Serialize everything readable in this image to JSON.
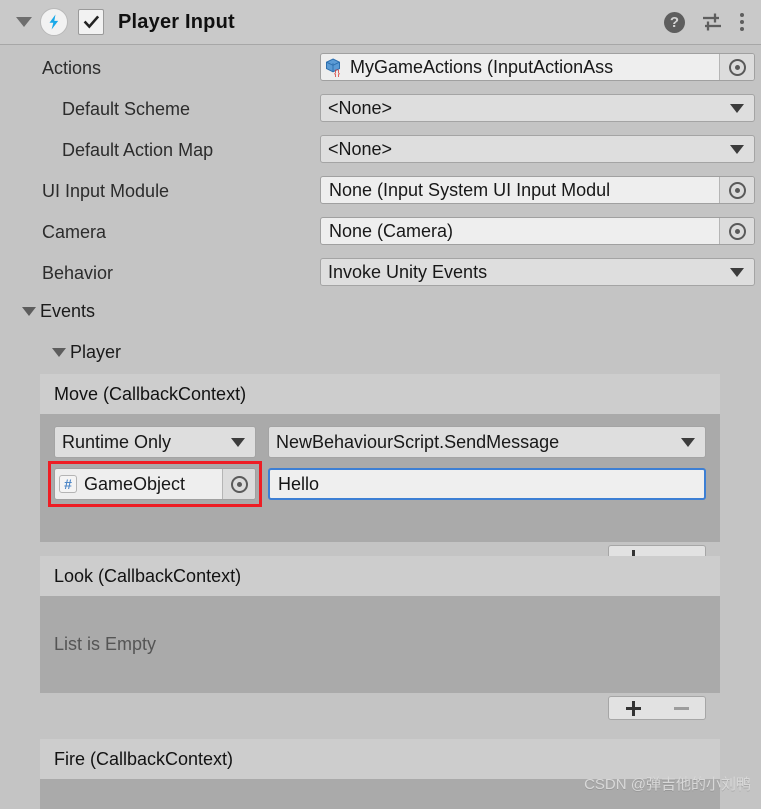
{
  "component": {
    "title": "Player Input",
    "enabled_checkbox": true,
    "expanded": true,
    "icons": {
      "foldout": "triangle-down-icon",
      "component": "lightning-bolt-icon",
      "help": "?",
      "preset": "preset-sliders-icon",
      "menu": "kebab-menu-icon"
    }
  },
  "properties": [
    {
      "label": "Actions",
      "type": "object",
      "value": "MyGameActions (InputActionAss",
      "icon": "input-action-asset-icon"
    },
    {
      "label": "Default Scheme",
      "type": "popup",
      "value": "<None>"
    },
    {
      "label": "Default Action Map",
      "type": "popup",
      "value": "<None>"
    },
    {
      "label": "UI Input Module",
      "type": "object",
      "value": "None (Input System UI Input Modul",
      "icon": ""
    },
    {
      "label": "Camera",
      "type": "object",
      "value": "None (Camera)",
      "icon": ""
    },
    {
      "label": "Behavior",
      "type": "popup",
      "value": "Invoke Unity Events"
    }
  ],
  "events": {
    "label": "Events",
    "group_label": "Player",
    "entries": [
      {
        "title": "Move (CallbackContext)",
        "empty": false,
        "empty_text": "",
        "rows": [
          {
            "call_state": "Runtime Only",
            "method": "NewBehaviourScript.SendMessage",
            "target_object": "GameObject",
            "target_icon": "gameobject-hash-icon",
            "argument": "Hello",
            "highlighted": true
          }
        ],
        "add_label": "+",
        "remove_label": "–",
        "remove_enabled": true
      },
      {
        "title": "Look (CallbackContext)",
        "empty": true,
        "empty_text": "List is Empty",
        "rows": [],
        "add_label": "+",
        "remove_label": "–",
        "remove_enabled": false
      },
      {
        "title": "Fire (CallbackContext)",
        "empty": true,
        "empty_text": "",
        "rows": [],
        "add_label": "+",
        "remove_label": "–",
        "remove_enabled": false
      }
    ]
  },
  "watermark": "CSDN @弹吉他的小刘鸭",
  "colors": {
    "background": "#c4c4c4",
    "header": "#c9c9c9",
    "event_header": "#cdcdcd",
    "event_body": "#aaaaaa",
    "field": "#eeeeee",
    "popup": "#dedede",
    "accent_blue": "#3d7fd4",
    "highlight_red": "#ee1d24",
    "bolt_blue": "#17a8e8"
  }
}
